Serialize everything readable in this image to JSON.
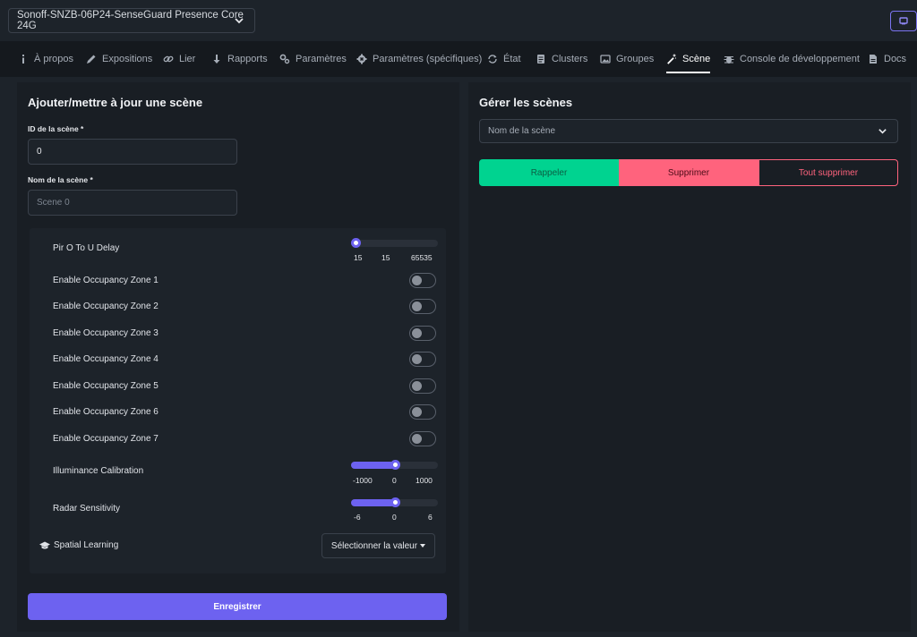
{
  "device": {
    "name": "Sonoff-SNZB-06P24-SenseGuard Presence Core 24G",
    "chevron_icon": "chevron-down-icon",
    "corner_icon": "monitor-icon"
  },
  "tabs": [
    {
      "label": "À propos",
      "icon": "info-icon"
    },
    {
      "label": "Expositions",
      "icon": "pencil-icon"
    },
    {
      "label": "Lier",
      "icon": "link-icon"
    },
    {
      "label": "Rapports",
      "icon": "arrow-down-icon"
    },
    {
      "label": "Paramètres",
      "icon": "cogs-icon"
    },
    {
      "label": "Paramètres (spécifiques)",
      "icon": "gear-icon"
    },
    {
      "label": "État",
      "icon": "sync-icon"
    },
    {
      "label": "Clusters",
      "icon": "document-icon"
    },
    {
      "label": "Groupes",
      "icon": "image-icon"
    },
    {
      "label": "Scène",
      "icon": "magic-wand-icon",
      "active": true
    },
    {
      "label": "Console de développement",
      "icon": "bug-icon"
    },
    {
      "label": "Docs",
      "icon": "file-icon"
    }
  ],
  "add_scene": {
    "title": "Ajouter/mettre à jour une scène",
    "id_label": "ID de la scène *",
    "id_value": "0",
    "name_label": "Nom de la scène *",
    "name_placeholder": "Scene 0",
    "props": {
      "pir_delay": {
        "label": "Pir O To U Delay",
        "min": "15",
        "value": "15",
        "max": "65535",
        "level": 0.0
      },
      "zones": [
        {
          "label": "Enable Occupancy Zone 1",
          "on": false
        },
        {
          "label": "Enable Occupancy Zone 2",
          "on": false
        },
        {
          "label": "Enable Occupancy Zone 3",
          "on": false
        },
        {
          "label": "Enable Occupancy Zone 4",
          "on": false
        },
        {
          "label": "Enable Occupancy Zone 5",
          "on": false
        },
        {
          "label": "Enable Occupancy Zone 6",
          "on": false
        },
        {
          "label": "Enable Occupancy Zone 7",
          "on": false
        }
      ],
      "illuminance": {
        "label": "Illuminance Calibration",
        "min": "-1000",
        "value": "0",
        "max": "1000",
        "level": 0.5
      },
      "radar": {
        "label": "Radar Sensitivity",
        "min": "-6",
        "value": "0",
        "max": "6",
        "level": 0.5
      },
      "spatial": {
        "label": "Spatial Learning",
        "icon": "graduation-cap-icon",
        "select_label": "Sélectionner la valeur"
      }
    },
    "save_label": "Enregistrer"
  },
  "manage_scenes": {
    "title": "Gérer les scènes",
    "select_placeholder": "Nom de la scène",
    "recall_label": "Rappeler",
    "delete_label": "Supprimer",
    "delete_all_label": "Tout supprimer"
  },
  "colors": {
    "accent": "#6d62f0",
    "success": "#00d390",
    "danger": "#ff637d"
  }
}
